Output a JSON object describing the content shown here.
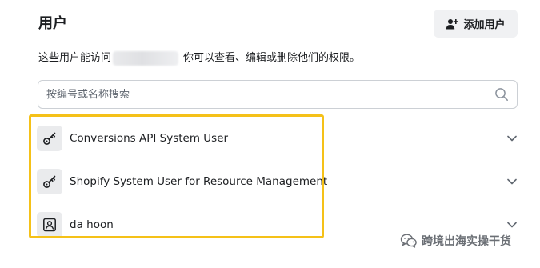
{
  "header": {
    "title": "用户",
    "add_button_label": "添加用户"
  },
  "description": {
    "before": "这些用户能访问",
    "after": "你可以查看、编辑或删除他们的权限。"
  },
  "search": {
    "placeholder": "按编号或名称搜索"
  },
  "users": [
    {
      "name": "Conversions API System User",
      "avatar_icon": "key-icon"
    },
    {
      "name": "Shopify System User for Resource Management",
      "avatar_icon": "key-icon"
    },
    {
      "name": "da hoon",
      "avatar_icon": "id-card-icon"
    }
  ],
  "watermark": {
    "text": "跨境出海实操干货"
  },
  "colors": {
    "highlight_border": "#f5c118",
    "button_bg": "#f0f1f3",
    "avatar_bg": "#eaebed",
    "text": "#1c1e21"
  }
}
